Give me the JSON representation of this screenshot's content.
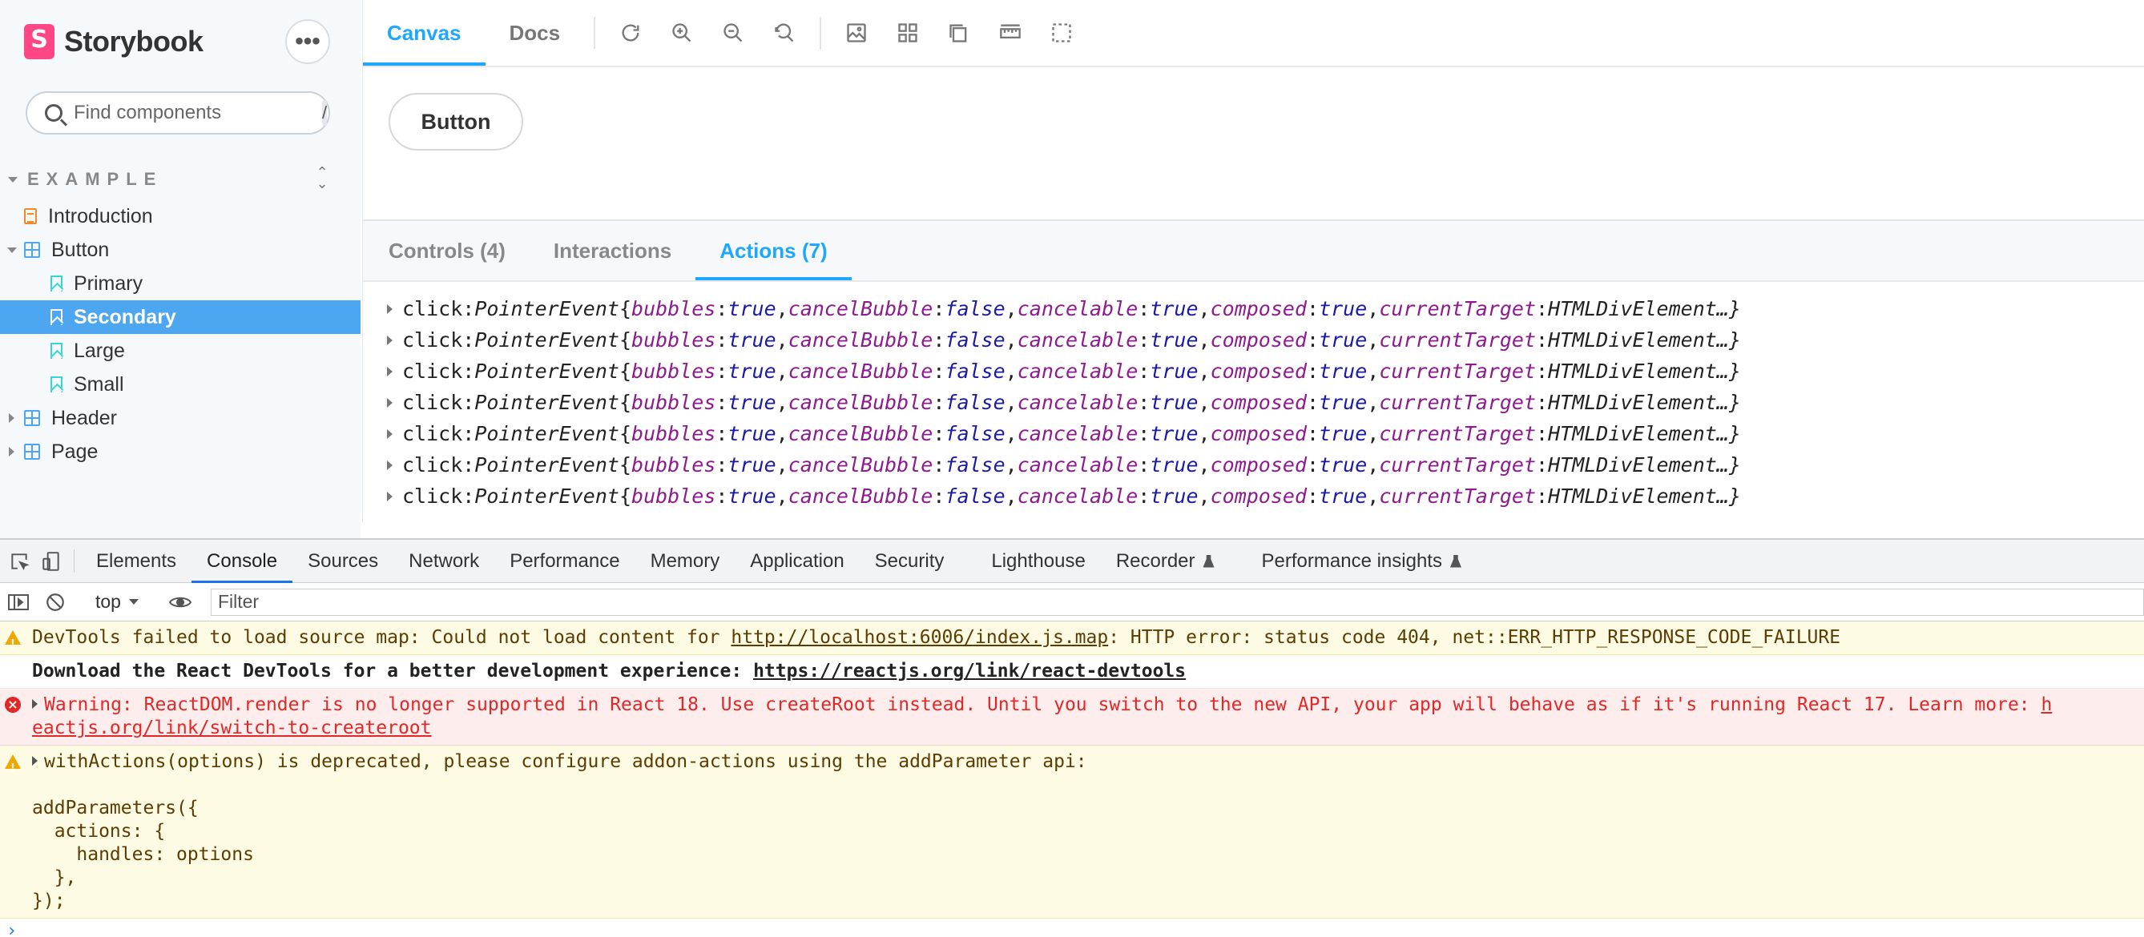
{
  "sidebar": {
    "brand": "Storybook",
    "more_label": "•••",
    "search_placeholder": "Find components",
    "search_shortcut": "/",
    "group": "EXAMPLE",
    "items": {
      "introduction": "Introduction",
      "button": "Button",
      "primary": "Primary",
      "secondary": "Secondary",
      "large": "Large",
      "small": "Small",
      "header": "Header",
      "page": "Page"
    }
  },
  "toolbar": {
    "tabs": [
      "Canvas",
      "Docs"
    ],
    "active_tab": "Canvas",
    "icons": [
      "refresh-icon",
      "zoom-in-icon",
      "zoom-out-icon",
      "zoom-reset-icon",
      "background-icon",
      "grid-icon",
      "viewport-icon",
      "measure-icon",
      "outline-icon"
    ]
  },
  "canvas": {
    "button_label": "Button"
  },
  "addons": {
    "tabs": [
      "Controls (4)",
      "Interactions",
      "Actions (7)"
    ],
    "active_tab": "Actions (7)",
    "action": {
      "name": "click",
      "type": "PointerEvent",
      "props": [
        {
          "key": "bubbles",
          "value": "true"
        },
        {
          "key": "cancelBubble",
          "value": "false"
        },
        {
          "key": "cancelable",
          "value": "true"
        },
        {
          "key": "composed",
          "value": "true"
        }
      ],
      "last_key": "currentTarget",
      "last_value": "HTMLDivElement…}"
    },
    "action_count": 7
  },
  "devtools": {
    "tabs": [
      "Elements",
      "Console",
      "Sources",
      "Network",
      "Performance",
      "Memory",
      "Application",
      "Security",
      "Lighthouse",
      "Recorder",
      "Performance insights"
    ],
    "active_tab": "Console",
    "context": "top",
    "filter_placeholder": "Filter",
    "messages": {
      "m1_pre": "DevTools failed to load source map: Could not load content for ",
      "m1_link": "http://localhost:6006/index.js.map",
      "m1_post": ": HTTP error: status code 404, net::ERR_HTTP_RESPONSE_CODE_FAILURE",
      "m2_pre": "Download the React DevTools for a better development experience: ",
      "m2_link": "https://reactjs.org/link/react-devtools",
      "m3_line1": "Warning: ReactDOM.render is no longer supported in React 18. Use createRoot instead. Until you switch to the new API, your app will behave as if it's running React 17. Learn more: ",
      "m3_link_a": "h",
      "m3_link_b": "eactjs.org/link/switch-to-createroot",
      "m4_line1": "withActions(options) is deprecated, please configure addon-actions using the addParameter api:",
      "m4_code": "addParameters({\n  actions: {\n    handles: options\n  },\n});"
    },
    "prompt": "›"
  }
}
